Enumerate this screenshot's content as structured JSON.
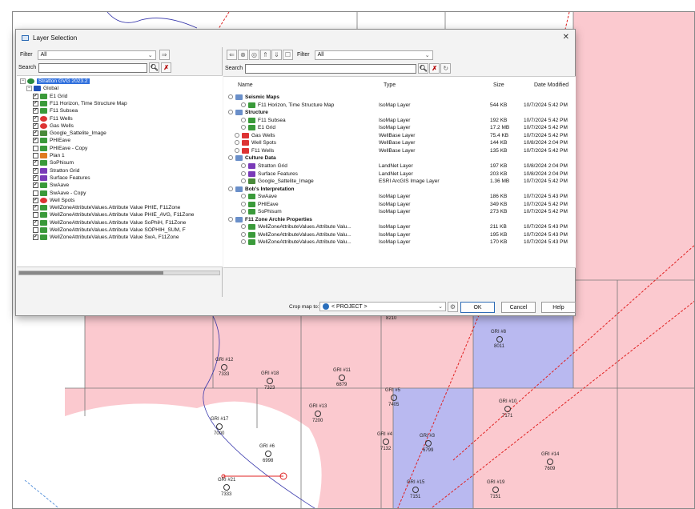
{
  "dialog": {
    "title": "Layer Selection",
    "close_glyph": "✕"
  },
  "left_panel": {
    "filter_label": "Filter",
    "filter_value": "All",
    "search_label": "Search",
    "tree": [
      {
        "label": "Stratton GVG 2023.2",
        "indent": 0,
        "checked": null,
        "icon": "project-icon",
        "color": "#2b8a3e",
        "selected": true
      },
      {
        "label": "Global",
        "indent": 1,
        "checked": null,
        "icon": "folder-icon",
        "color": "#1f4fb8"
      },
      {
        "label": "E1 Grid",
        "indent": 2,
        "checked": true,
        "icon": "grid-layer-icon",
        "color": "#3a9a3a"
      },
      {
        "label": "F11 Horizon, Time Structure Map",
        "indent": 2,
        "checked": true,
        "icon": "isomap-icon",
        "color": "#3a9a3a"
      },
      {
        "label": "F11 Subsea",
        "indent": 2,
        "checked": true,
        "icon": "isomap-icon",
        "color": "#3a9a3a"
      },
      {
        "label": "F11 Wells",
        "indent": 2,
        "checked": true,
        "icon": "wells-icon",
        "color": "#d33"
      },
      {
        "label": "Gas Wells",
        "indent": 2,
        "checked": true,
        "icon": "wells-icon",
        "color": "#d33"
      },
      {
        "label": "Google_Sattelite_Image",
        "indent": 2,
        "checked": true,
        "icon": "image-layer-icon",
        "color": "#4a8a3a"
      },
      {
        "label": "PHIEave",
        "indent": 2,
        "checked": true,
        "icon": "isomap-icon",
        "color": "#3a9a3a"
      },
      {
        "label": "PHIEave - Copy",
        "indent": 2,
        "checked": false,
        "icon": "isomap-icon",
        "color": "#3a9a3a"
      },
      {
        "label": "Plan 1",
        "indent": 2,
        "checked": false,
        "icon": "plan-icon",
        "color": "#e07a20"
      },
      {
        "label": "SoPhisum",
        "indent": 2,
        "checked": true,
        "icon": "isomap-icon",
        "color": "#3a9a3a"
      },
      {
        "label": "Stratton Grid",
        "indent": 2,
        "checked": true,
        "icon": "landnet-icon",
        "color": "#7a3ab8"
      },
      {
        "label": "Surface Features",
        "indent": 2,
        "checked": true,
        "icon": "landnet-icon",
        "color": "#7a3ab8"
      },
      {
        "label": "SwAave",
        "indent": 2,
        "checked": true,
        "icon": "isomap-icon",
        "color": "#3a9a3a"
      },
      {
        "label": "SwAave - Copy",
        "indent": 2,
        "checked": false,
        "icon": "isomap-icon",
        "color": "#3a9a3a"
      },
      {
        "label": "Well Spots",
        "indent": 2,
        "checked": true,
        "icon": "wells-icon",
        "color": "#d33"
      },
      {
        "label": "WellZoneAttributeValues.Attribute Value PHIE, F11Zone",
        "indent": 2,
        "checked": true,
        "icon": "isomap-icon",
        "color": "#3a9a3a"
      },
      {
        "label": "WellZoneAttributeValues.Attribute Value PHIE_AVG, F11Zone",
        "indent": 2,
        "checked": false,
        "icon": "isomap-icon",
        "color": "#3a9a3a"
      },
      {
        "label": "WellZoneAttributeValues.Attribute Value SoPhiH, F11Zone",
        "indent": 2,
        "checked": true,
        "icon": "isomap-icon",
        "color": "#3a9a3a"
      },
      {
        "label": "WellZoneAttributeValues.Attribute Value SOPHIH_SUM, F",
        "indent": 2,
        "checked": false,
        "icon": "isomap-icon",
        "color": "#3a9a3a"
      },
      {
        "label": "WellZoneAttributeValues.Attribute Value SwA, F11Zone",
        "indent": 2,
        "checked": true,
        "icon": "isomap-icon",
        "color": "#3a9a3a"
      }
    ]
  },
  "right_panel": {
    "filter_label": "Filter",
    "filter_value": "All",
    "search_label": "Search",
    "columns": {
      "name": "Name",
      "type": "Type",
      "size": "Size",
      "date": "Date Modified"
    },
    "rows": [
      {
        "name": "Seismic Maps",
        "group": true
      },
      {
        "name": "F11 Horizon, Time Structure Map",
        "type": "IsoMap Layer",
        "size": "544 KB",
        "date": "10/7/2024 5:42 PM",
        "color": "#3a9a3a"
      },
      {
        "name": "Structure",
        "group": true
      },
      {
        "name": "F11 Subsea",
        "type": "IsoMap Layer",
        "size": "192 KB",
        "date": "10/7/2024 5:42 PM",
        "color": "#3a9a3a"
      },
      {
        "name": "E1 Grid",
        "type": "IsoMap Layer",
        "size": "17.2 MB",
        "date": "10/7/2024 5:42 PM",
        "color": "#3a9a3a"
      },
      {
        "name": "Gas Wells",
        "type": "WellBase Layer",
        "size": "75.4 KB",
        "date": "10/7/2024 5:42 PM",
        "color": "#d33",
        "level": 1
      },
      {
        "name": "Well Spots",
        "type": "WellBase Layer",
        "size": "144 KB",
        "date": "10/8/2024 2:04 PM",
        "color": "#d33",
        "level": 1
      },
      {
        "name": "F11 Wells",
        "type": "WellBase Layer",
        "size": "135 KB",
        "date": "10/7/2024 5:42 PM",
        "color": "#d33",
        "level": 1
      },
      {
        "name": "Culture Data",
        "group": true
      },
      {
        "name": "Stratton Grid",
        "type": "LandNet Layer",
        "size": "197 KB",
        "date": "10/8/2024 2:04 PM",
        "color": "#7a3ab8"
      },
      {
        "name": "Surface Features",
        "type": "LandNet Layer",
        "size": "203 KB",
        "date": "10/8/2024 2:04 PM",
        "color": "#7a3ab8"
      },
      {
        "name": "Google_Sattelite_Image",
        "type": "ESRI ArcGIS Image Layer",
        "size": "1.36 MB",
        "date": "10/7/2024 5:42 PM",
        "color": "#4a8a3a"
      },
      {
        "name": "Bob's Interpretation",
        "group": true
      },
      {
        "name": "SwAave",
        "type": "IsoMap Layer",
        "size": "186 KB",
        "date": "10/7/2024 5:43 PM",
        "color": "#3a9a3a"
      },
      {
        "name": "PHIEave",
        "type": "IsoMap Layer",
        "size": "349 KB",
        "date": "10/7/2024 5:42 PM",
        "color": "#3a9a3a"
      },
      {
        "name": "SoPhisum",
        "type": "IsoMap Layer",
        "size": "273 KB",
        "date": "10/7/2024 5:42 PM",
        "color": "#3a9a3a"
      },
      {
        "name": "F11 Zone Archie Properties",
        "group": true
      },
      {
        "name": "WellZoneAttributeValues.Attribute Valu...",
        "type": "IsoMap Layer",
        "size": "211 KB",
        "date": "10/7/2024 5:43 PM",
        "color": "#3a9a3a"
      },
      {
        "name": "WellZoneAttributeValues.Attribute Valu...",
        "type": "IsoMap Layer",
        "size": "195 KB",
        "date": "10/7/2024 5:43 PM",
        "color": "#3a9a3a"
      },
      {
        "name": "WellZoneAttributeValues.Attribute Valu...",
        "type": "IsoMap Layer",
        "size": "170 KB",
        "date": "10/7/2024 5:43 PM",
        "color": "#3a9a3a"
      }
    ]
  },
  "footer": {
    "crop_label": "Crop map to:",
    "crop_value": "< PROJECT >",
    "ok": "OK",
    "cancel": "Cancel",
    "help": "Help"
  },
  "map": {
    "wells": [
      {
        "label": "GRI #12",
        "value": "7333"
      },
      {
        "label": "GRI #18",
        "value": "7323"
      },
      {
        "label": "GRI #11",
        "value": "6879"
      },
      {
        "label": "GRI #8",
        "value": "8011"
      },
      {
        "label": "GRI #5",
        "value": "7405"
      },
      {
        "label": "GRI #10",
        "value": "7171"
      },
      {
        "label": "GRI #17",
        "value": "7000"
      },
      {
        "label": "GRI #13",
        "value": "7200"
      },
      {
        "label": "GRI #4",
        "value": "7132"
      },
      {
        "label": "GRI #3",
        "value": "6799"
      },
      {
        "label": "GRI #6",
        "value": "6998"
      },
      {
        "label": "GRI #14",
        "value": "7609"
      },
      {
        "label": "GRI #21",
        "value": "7333"
      },
      {
        "label": "GRI #15",
        "value": "7151"
      },
      {
        "label": "GRI #19",
        "value": "7151"
      },
      {
        "label": "",
        "value": "8210"
      }
    ],
    "colors": {
      "pink": "#fbc9cf",
      "blue": "#b9b9f0",
      "fault": "#e02020"
    }
  }
}
